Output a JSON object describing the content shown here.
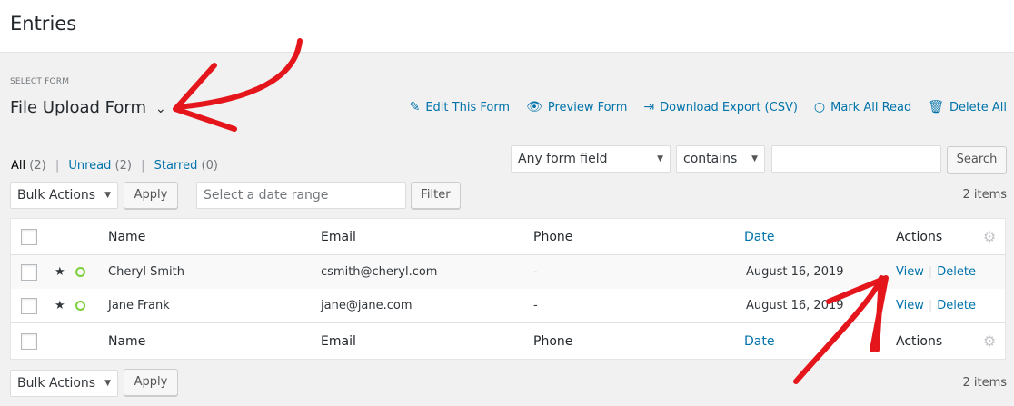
{
  "page": {
    "title": "Entries"
  },
  "form_selector": {
    "label": "SELECT FORM",
    "value": "File Upload Form",
    "chevron_icon": "chevron-down-icon"
  },
  "form_actions": [
    {
      "label": "Edit This Form",
      "icon": "pencil-icon",
      "glyph": "✎"
    },
    {
      "label": "Preview Form",
      "icon": "eye-icon",
      "glyph": "👁"
    },
    {
      "label": "Download Export (CSV)",
      "icon": "export-icon",
      "glyph": "⇥"
    },
    {
      "label": "Mark All Read",
      "icon": "circle-icon",
      "glyph": "○"
    },
    {
      "label": "Delete All",
      "icon": "trash-icon",
      "glyph": "🗑"
    }
  ],
  "filters": {
    "all": {
      "label": "All",
      "count": "(2)"
    },
    "unread": {
      "label": "Unread",
      "count": "(2)"
    },
    "starred": {
      "label": "Starred",
      "count": "(0)"
    },
    "separator": "|"
  },
  "search": {
    "field_select": "Any form field",
    "operator_select": "contains",
    "value": "",
    "button": "Search"
  },
  "bulk_top": {
    "select": "Bulk Actions",
    "apply": "Apply"
  },
  "date_range": {
    "placeholder": "Select a date range",
    "filter_button": "Filter"
  },
  "items_count": "2 items",
  "table": {
    "columns": {
      "name": "Name",
      "email": "Email",
      "phone": "Phone",
      "date": "Date",
      "actions": "Actions"
    },
    "rows": [
      {
        "name": "Cheryl Smith",
        "email": "csmith@cheryl.com",
        "phone": "-",
        "date": "August 16, 2019",
        "view": "View",
        "delete": "Delete"
      },
      {
        "name": "Jane Frank",
        "email": "jane@jane.com",
        "phone": "-",
        "date": "August 16, 2019",
        "view": "View",
        "delete": "Delete"
      }
    ],
    "action_separator": "|"
  },
  "bulk_bottom": {
    "select": "Bulk Actions",
    "apply": "Apply"
  },
  "colors": {
    "link": "#0073aa",
    "annotation": "#e4161b",
    "unread_dot": "#7ad03a"
  }
}
